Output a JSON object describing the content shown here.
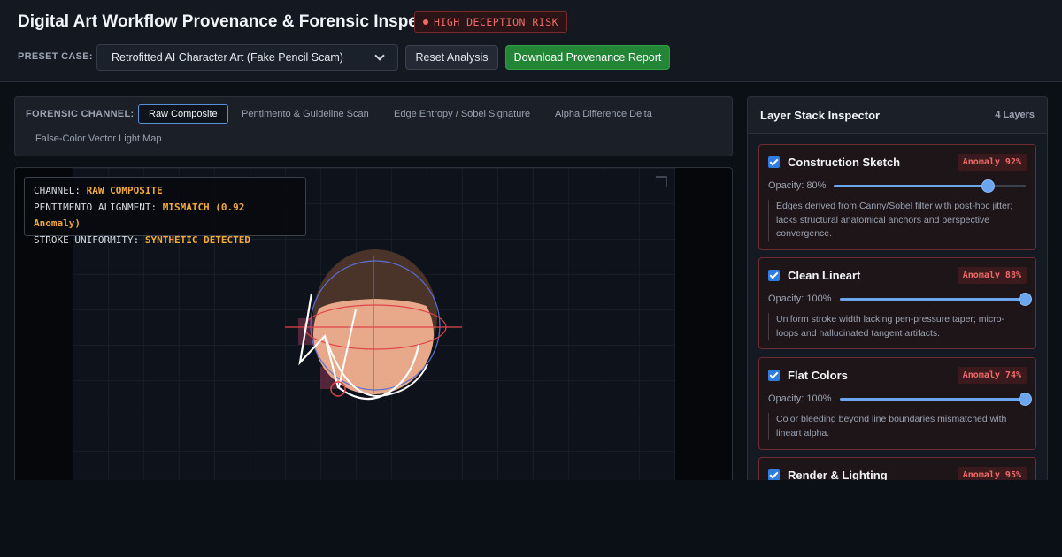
{
  "header": {
    "title": "Digital Art Workflow Provenance & Forensic Inspector",
    "risk_badge": "HIGH DECEPTION RISK",
    "preset_label": "PRESET CASE:",
    "preset_value": "Retrofitted AI Character Art (Fake Pencil Scam)",
    "reset_label": "Reset Analysis",
    "download_label": "Download Provenance Report"
  },
  "channels": {
    "label": "FORENSIC CHANNEL:",
    "tabs": [
      {
        "label": "Raw Composite",
        "active": true
      },
      {
        "label": "Pentimento & Guideline Scan",
        "active": false
      },
      {
        "label": "Edge Entropy / Sobel Signature",
        "active": false
      },
      {
        "label": "Alpha Difference Delta",
        "active": false
      },
      {
        "label": "False-Color Vector Light Map",
        "active": false
      }
    ]
  },
  "hud": {
    "channel_key": "CHANNEL:",
    "channel_value": "RAW COMPOSITE",
    "alignment_key": "PENTIMENTO ALIGNMENT:",
    "alignment_value": "MISMATCH (0.92 Anomaly)",
    "stroke_key": "STROKE UNIFORMITY:",
    "stroke_value": "SYNTHETIC DETECTED"
  },
  "layer_panel": {
    "title": "Layer Stack Inspector",
    "count": "4 Layers",
    "layers": [
      {
        "name": "Construction Sketch",
        "badge": "Anomaly 92%",
        "opacity_label": "Opacity: 80%",
        "opacity": 0.8,
        "checked": true,
        "note": "Edges derived from Canny/Sobel filter with post-hoc jitter; lacks structural anatomical anchors and perspective convergence."
      },
      {
        "name": "Clean Lineart",
        "badge": "Anomaly 88%",
        "opacity_label": "Opacity: 100%",
        "opacity": 1.0,
        "checked": true,
        "note": "Uniform stroke width lacking pen-pressure taper; micro-loops and hallucinated tangent artifacts."
      },
      {
        "name": "Flat Colors",
        "badge": "Anomaly 74%",
        "opacity_label": "Opacity: 100%",
        "opacity": 1.0,
        "checked": true,
        "note": "Color bleeding beyond line boundaries mismatched with lineart alpha."
      },
      {
        "name": "Render & Lighting",
        "badge": "Anomaly 95%",
        "checked": true
      }
    ]
  },
  "colors": {
    "accent": "#5b8fd6",
    "danger": "#f06a6a",
    "warning": "#f2a93b",
    "success": "#238636",
    "skin": "#e8a98a",
    "hair": "#4a3328"
  }
}
